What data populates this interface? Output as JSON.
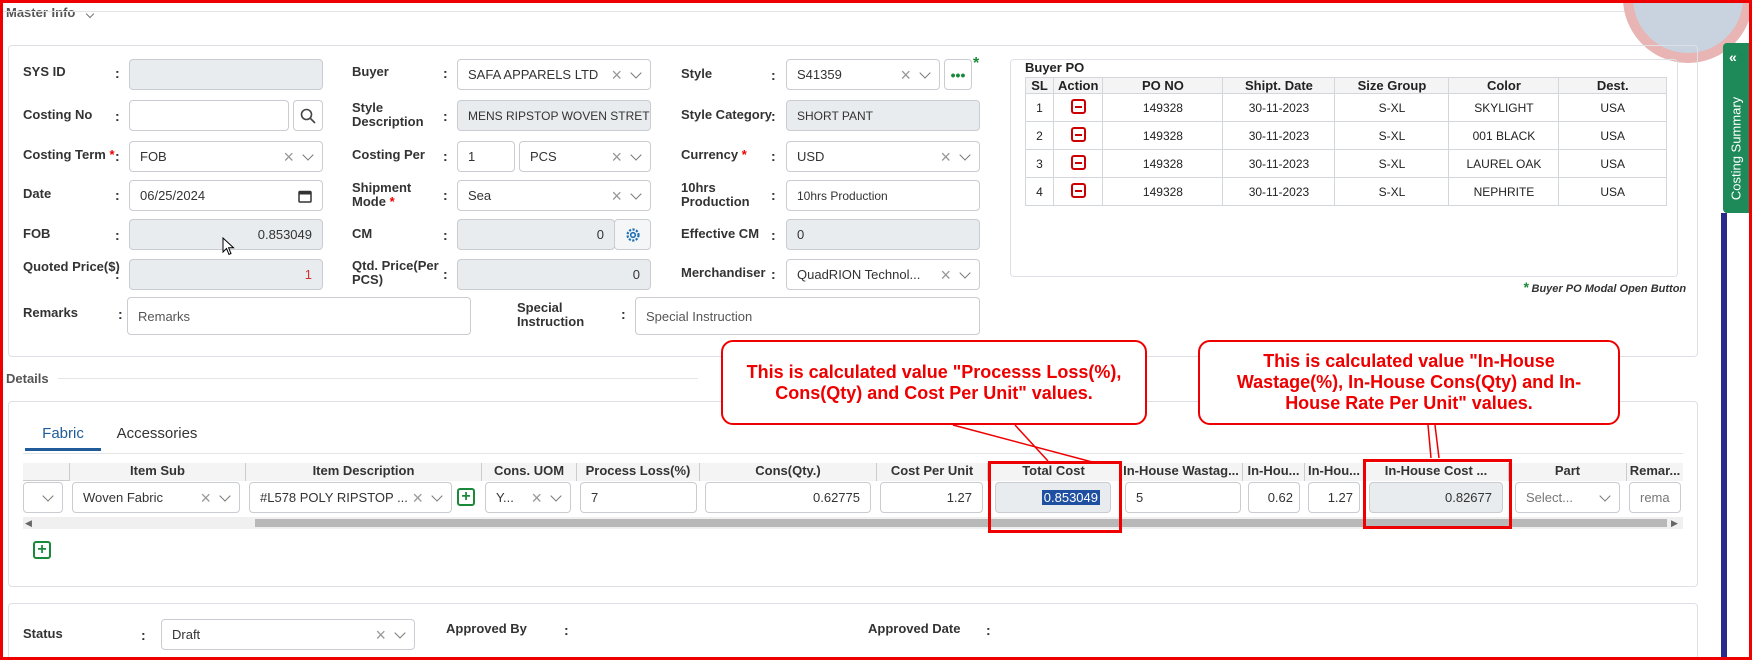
{
  "master": {
    "section_title": "Master Info",
    "sys_id_label": "SYS ID",
    "sys_id_value": "",
    "costing_no_label": "Costing No",
    "costing_no_value": "",
    "costing_term_label": "Costing Term",
    "costing_term_value": "FOB",
    "date_label": "Date",
    "date_value": "06/25/2024",
    "fob_label": "FOB",
    "fob_value": "0.853049",
    "quoted_label": "Quoted Price($)",
    "quoted_value": "1",
    "remarks_label": "Remarks",
    "remarks_placeholder": "Remarks",
    "buyer_label": "Buyer",
    "buyer_value": "SAFA APPARELS LTD",
    "style_desc_label": "Style Description",
    "style_desc_value": "MENS RIPSTOP WOVEN STRETCH",
    "costing_per_label": "Costing Per",
    "costing_per_qty": "1",
    "costing_per_unit": "PCS",
    "shipment_label": "Shipment Mode",
    "shipment_value": "Sea",
    "cm_label": "CM",
    "cm_value": "0",
    "qtd_label": "Qtd. Price(Per PCS)",
    "qtd_value": "0",
    "special_label": "Special Instruction",
    "special_placeholder": "Special Instruction",
    "style_label": "Style",
    "style_value": "S41359",
    "style_cat_label": "Style Category",
    "style_cat_value": "SHORT PANT",
    "currency_label": "Currency",
    "currency_value": "USD",
    "tenhrs_label": "10hrs Production",
    "tenhrs_value": "10hrs Production",
    "eff_cm_label": "Effective CM",
    "eff_cm_value": "0",
    "merch_label": "Merchandiser",
    "merch_value": "QuadRION Technol..."
  },
  "buyer_po": {
    "title": "Buyer PO",
    "columns": [
      "SL",
      "Action",
      "PO NO",
      "Shipt. Date",
      "Size Group",
      "Color",
      "Dest."
    ],
    "rows": [
      {
        "sl": "1",
        "po": "149328",
        "date": "30-11-2023",
        "size": "S-XL",
        "color": "SKYLIGHT",
        "dest": "USA"
      },
      {
        "sl": "2",
        "po": "149328",
        "date": "30-11-2023",
        "size": "S-XL",
        "color": "001 BLACK",
        "dest": "USA"
      },
      {
        "sl": "3",
        "po": "149328",
        "date": "30-11-2023",
        "size": "S-XL",
        "color": "LAUREL OAK",
        "dest": "USA"
      },
      {
        "sl": "4",
        "po": "149328",
        "date": "30-11-2023",
        "size": "S-XL",
        "color": "NEPHRITE",
        "dest": "USA"
      }
    ],
    "note": "Buyer PO Modal Open Button"
  },
  "details": {
    "section_title": "Details",
    "tabs": [
      "Fabric",
      "Accessories"
    ],
    "columns": {
      "item_sub": "Item Sub",
      "item_desc": "Item Description",
      "uom": "Cons. UOM",
      "loss": "Process Loss(%)",
      "cons": "Cons(Qty.)",
      "cpu": "Cost Per Unit",
      "total": "Total Cost",
      "ih_wastage": "In-House Wastag...",
      "ih_cons": "In-Hou...",
      "ih_rate": "In-Hou...",
      "ih_cost": "In-House Cost ...",
      "part": "Part",
      "remarks": "Remar..."
    },
    "row": {
      "item_sub": "Woven Fabric",
      "item_desc": "#L578 POLY RIPSTOP ...",
      "uom": "Y...",
      "loss": "7",
      "cons": "0.62775",
      "cpu": "1.27",
      "total": "0.853049",
      "ih_wastage": "5",
      "ih_cons": "0.62",
      "ih_rate": "1.27",
      "ih_cost": "0.82677",
      "part": "Select...",
      "remarks": "rema"
    }
  },
  "callouts": {
    "left": "This is calculated value \"Processs Loss(%), Cons(Qty) and Cost Per Unit\" values.",
    "right": "This is calculated value \"In-House Wastage(%), In-House Cons(Qty) and In-House Rate Per Unit\" values."
  },
  "footer": {
    "status_label": "Status",
    "status_value": "Draft",
    "approved_by_label": "Approved By",
    "approved_date_label": "Approved Date"
  },
  "side_tab": {
    "label": "Costing Summary"
  },
  "colors": {
    "accent": "#1f5c99",
    "annotation": "#e00000",
    "side_tab": "#1e8a5a",
    "add_icon": "#1a8a3a"
  }
}
